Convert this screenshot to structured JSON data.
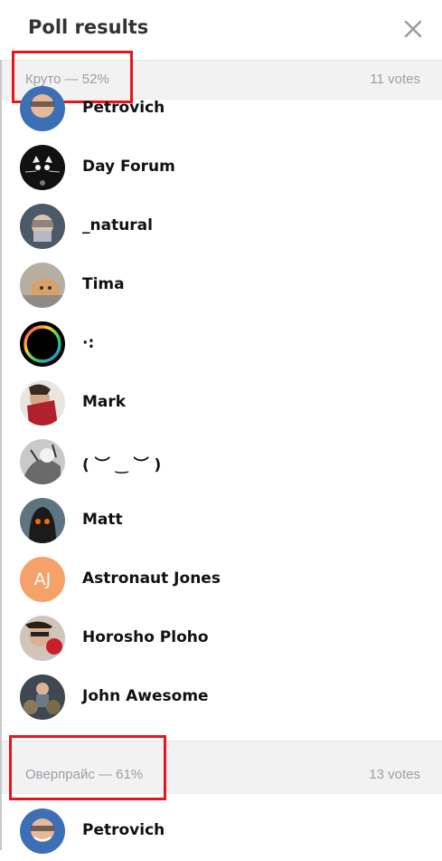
{
  "header": {
    "title": "Poll results",
    "close_icon": "close-icon"
  },
  "sections": [
    {
      "option": "Круто — 52%",
      "votes": "11 votes",
      "voters": [
        {
          "name": "Petrovich",
          "avatar_color": "#4a7fc1"
        },
        {
          "name": "Day Forum",
          "avatar_color": "#1a1a1a"
        },
        {
          "name": "_natural",
          "avatar_color": "#5a6a7a"
        },
        {
          "name": "Tima",
          "avatar_color": "#c9b9a5"
        },
        {
          "name": "·:",
          "avatar_color": "#000000"
        },
        {
          "name": "Mark",
          "avatar_color": "#8a3b3b"
        },
        {
          "name": "( ︶ ‿ ︶ )",
          "avatar_color": "#9a9a9a"
        },
        {
          "name": "Matt",
          "avatar_color": "#5b6f7a"
        },
        {
          "name": "Astronaut Jones",
          "avatar_color": "#f5a26a",
          "initials": "AJ"
        },
        {
          "name": "Horosho Ploho",
          "avatar_color": "#7a5a4a"
        },
        {
          "name": "John Awesome",
          "avatar_color": "#4a5560"
        }
      ]
    },
    {
      "option": "Оверпрайс — 61%",
      "votes": "13 votes",
      "voters": [
        {
          "name": "Petrovich",
          "avatar_color": "#4a7fc1"
        }
      ]
    }
  ]
}
